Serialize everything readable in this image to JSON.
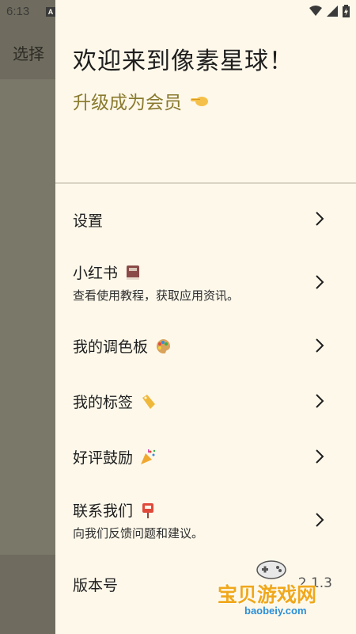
{
  "status_bar": {
    "time": "6:13",
    "a_icon": "A"
  },
  "background": {
    "select_label": "选择"
  },
  "drawer": {
    "welcome": "欢迎来到像素星球！",
    "upgrade": "升级成为会员"
  },
  "menu": [
    {
      "label": "设置",
      "sub": "",
      "icon": ""
    },
    {
      "label": "小红书",
      "sub": "查看使用教程，获取应用资讯。",
      "icon": "book-icon"
    },
    {
      "label": "我的调色板",
      "sub": "",
      "icon": "palette-icon"
    },
    {
      "label": "我的标签",
      "sub": "",
      "icon": "tag-icon"
    },
    {
      "label": "好评鼓励",
      "sub": "",
      "icon": "party-popper-icon"
    },
    {
      "label": "联系我们",
      "sub": "向我们反馈问题和建议。",
      "icon": "mailbox-icon"
    }
  ],
  "version": {
    "label": "版本号",
    "value": "2.1.3"
  },
  "watermark": {
    "title": "宝贝游戏网",
    "url": "baobeiy.com"
  },
  "colors": {
    "drawer_bg": "#fdf8ea",
    "scrim": "#7a7868",
    "accent_text": "#8a7a2e"
  }
}
